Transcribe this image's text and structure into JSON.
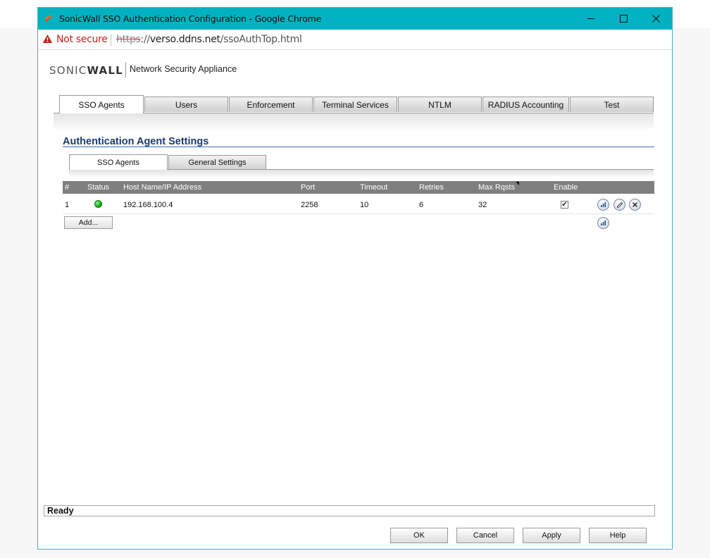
{
  "window": {
    "title": "SonicWall SSO Authentication Configuration - Google Chrome",
    "controls": [
      "minimize",
      "maximize",
      "close"
    ]
  },
  "address_bar": {
    "security_label": "Not secure",
    "url_scheme": "https",
    "url_sep": "://",
    "url_host": "verso.ddns.net",
    "url_path": "/ssoAuthTop.html"
  },
  "branding": {
    "logo_part1": "SONIC",
    "logo_part2": "WALL",
    "product": "Network Security Appliance"
  },
  "main_tabs": {
    "active": "SSO Agents",
    "items": [
      "SSO Agents",
      "Users",
      "Enforcement",
      "Terminal Services",
      "NTLM",
      "RADIUS Accounting",
      "Test"
    ]
  },
  "section": {
    "title": "Authentication Agent Settings"
  },
  "sub_tabs": {
    "active": "SSO Agents",
    "items": [
      "SSO Agents",
      "General Settings"
    ]
  },
  "agents_table": {
    "columns": [
      "#",
      "Status",
      "Host Name/IP Address",
      "Port",
      "Timeout",
      "Retries",
      "Max Rqsts",
      "Enable"
    ],
    "rows": [
      {
        "num": "1",
        "status": "online",
        "host": "192.168.100.4",
        "port": "2258",
        "timeout": "10",
        "retries": "6",
        "max_rqsts": "32",
        "enabled": "✔"
      }
    ],
    "add_label": "Add..."
  },
  "status_bar": {
    "text": "Ready"
  },
  "buttons": {
    "ok": "OK",
    "cancel": "Cancel",
    "apply": "Apply",
    "help": "Help"
  },
  "colors": {
    "titlebar": "#00b2c1",
    "section_title": "#1a3a6e",
    "table_header": "#7f7f7f",
    "status_online": "#18a818",
    "not_secure": "#c5221f"
  }
}
